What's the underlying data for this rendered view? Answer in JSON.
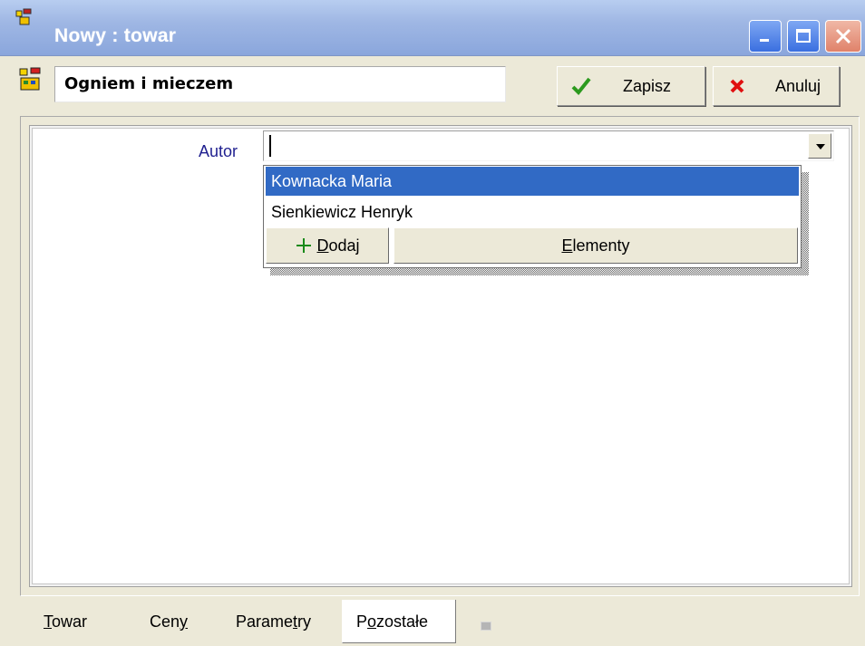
{
  "window": {
    "title": "Nowy : towar",
    "colors": {
      "titlebar": "#9fb7e4",
      "selection": "#316ac5",
      "close": "#e0826a"
    }
  },
  "toolbar": {
    "product_name": "Ogniem i mieczem",
    "save_label": "Zapisz",
    "cancel_label": "Anuluj"
  },
  "form": {
    "author_label": "Autor",
    "author_value": ""
  },
  "dropdown": {
    "items": [
      {
        "label": "Kownacka Maria",
        "selected": true
      },
      {
        "label": "Sienkiewicz Henryk",
        "selected": false
      }
    ],
    "add_label_underlined": "D",
    "add_label_rest": "odaj",
    "elements_label_underlined": "E",
    "elements_label_rest": "lementy"
  },
  "tabs": {
    "towar_u": "T",
    "towar_rest": "owar",
    "ceny_pre": "Cen",
    "ceny_u": "y",
    "parametry_pre": "Parame",
    "parametry_u": "t",
    "parametry_rest": "ry",
    "pozostale_pre": "P",
    "pozostale_u": "o",
    "pozostale_rest": "zostałe",
    "active": "Pozostałe"
  },
  "icons": {
    "title": "app-icon",
    "product": "product-icon",
    "save": "checkmark-icon",
    "cancel": "x-icon",
    "add": "plus-icon",
    "dropdown": "chevron-down-icon"
  }
}
